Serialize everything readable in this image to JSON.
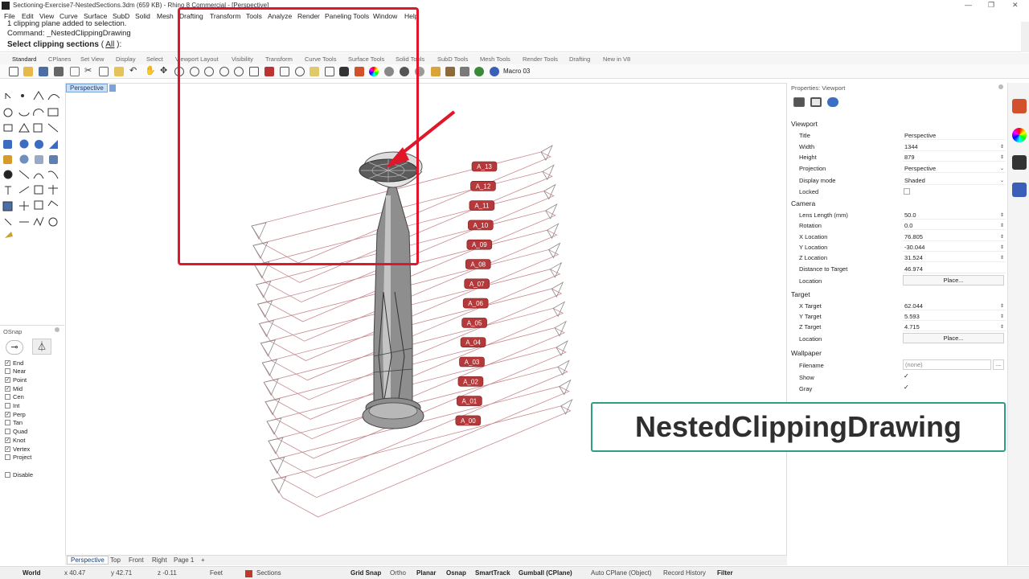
{
  "window": {
    "title": "Sectioning-Exercise7-NestedSections.3dm (659 KB) - Rhino 8 Commercial - [Perspective]"
  },
  "menu": [
    "File",
    "Edit",
    "View",
    "Curve",
    "Surface",
    "SubD",
    "Solid",
    "Mesh",
    "Drafting",
    "Transform",
    "Tools",
    "Analyze",
    "Render",
    "Paneling Tools",
    "Window",
    "Help"
  ],
  "command": {
    "history1": "1 clipping plane added to selection.",
    "history2": "Command: _NestedClippingDrawing",
    "prompt": "Select clipping sections",
    "option_open": " ( ",
    "option": "All",
    "option_close": " ):"
  },
  "toolbar_tabs": [
    "Standard",
    "CPlanes",
    "Set View",
    "Display",
    "Select",
    "Viewport Layout",
    "Visibility",
    "Transform",
    "Curve Tools",
    "Surface Tools",
    "Solid Tools",
    "SubD Tools",
    "Mesh Tools",
    "Render Tools",
    "Drafting",
    "New in V8"
  ],
  "macro_label": "Macro 03",
  "viewport": {
    "active_label": "Perspective",
    "bottom_tabs": [
      "Perspective",
      "Top",
      "Front",
      "Right",
      "Page 1"
    ],
    "add_tab": "+",
    "section_labels": [
      "A_13",
      "A_12",
      "A_11",
      "A_10",
      "A_09",
      "A_08",
      "A_07",
      "A_06",
      "A_05",
      "A_04",
      "A_03",
      "A_02",
      "A_01",
      "A_00"
    ]
  },
  "osnap": {
    "title": "OSnap",
    "items": [
      {
        "label": "End",
        "checked": true
      },
      {
        "label": "Near",
        "checked": false
      },
      {
        "label": "Point",
        "checked": true
      },
      {
        "label": "Mid",
        "checked": true
      },
      {
        "label": "Cen",
        "checked": false
      },
      {
        "label": "Int",
        "checked": false
      },
      {
        "label": "Perp",
        "checked": true
      },
      {
        "label": "Tan",
        "checked": false
      },
      {
        "label": "Quad",
        "checked": false
      },
      {
        "label": "Knot",
        "checked": true
      },
      {
        "label": "Vertex",
        "checked": true
      },
      {
        "label": "Project",
        "checked": false
      }
    ],
    "disable": {
      "label": "Disable",
      "checked": false
    }
  },
  "properties": {
    "title": "Properties: Viewport",
    "viewport_section": "Viewport",
    "title_label": "Title",
    "title_value": "Perspective",
    "width_label": "Width",
    "width_value": "1344",
    "height_label": "Height",
    "height_value": "879",
    "projection_label": "Projection",
    "projection_value": "Perspective",
    "display_label": "Display mode",
    "display_value": "Shaded",
    "locked_label": "Locked",
    "camera_section": "Camera",
    "lens_label": "Lens Length (mm)",
    "lens_value": "50.0",
    "rotation_label": "Rotation",
    "rotation_value": "0.0",
    "xloc_label": "X Location",
    "xloc_value": "76.805",
    "yloc_label": "Y Location",
    "yloc_value": "-30.044",
    "zloc_label": "Z Location",
    "zloc_value": "31.524",
    "dist_label": "Distance to Target",
    "dist_value": "46.974",
    "location_label": "Location",
    "place_label": "Place...",
    "target_section": "Target",
    "xt_label": "X Target",
    "xt_value": "62.044",
    "yt_label": "Y Target",
    "yt_value": "5.593",
    "zt_label": "Z Target",
    "zt_value": "4.715",
    "tloc_label": "Location",
    "tplace_label": "Place...",
    "wallpaper_section": "Wallpaper",
    "filename_label": "Filename",
    "filename_value": "(none)",
    "filename_btn": "...",
    "show_label": "Show",
    "gray_label": "Gray"
  },
  "status": {
    "cplane": "World",
    "x": "x 40.47",
    "y": "y 42.71",
    "z": "z -0.11",
    "units": "Feet",
    "layer": "Sections",
    "grid_snap": "Grid Snap",
    "ortho": "Ortho",
    "planar": "Planar",
    "osnap": "Osnap",
    "smarttrack": "SmartTrack",
    "gumball": "Gumball (CPlane)",
    "autocplane": "Auto CPlane (Object)",
    "record_history": "Record History",
    "filter": "Filter"
  },
  "banner_text": "NestedClippingDrawing",
  "colors": {
    "highlight": "#e0162b",
    "label_fill": "#b5383a",
    "banner_border": "#2e9e82",
    "clip_plane": "#c98a8f"
  }
}
